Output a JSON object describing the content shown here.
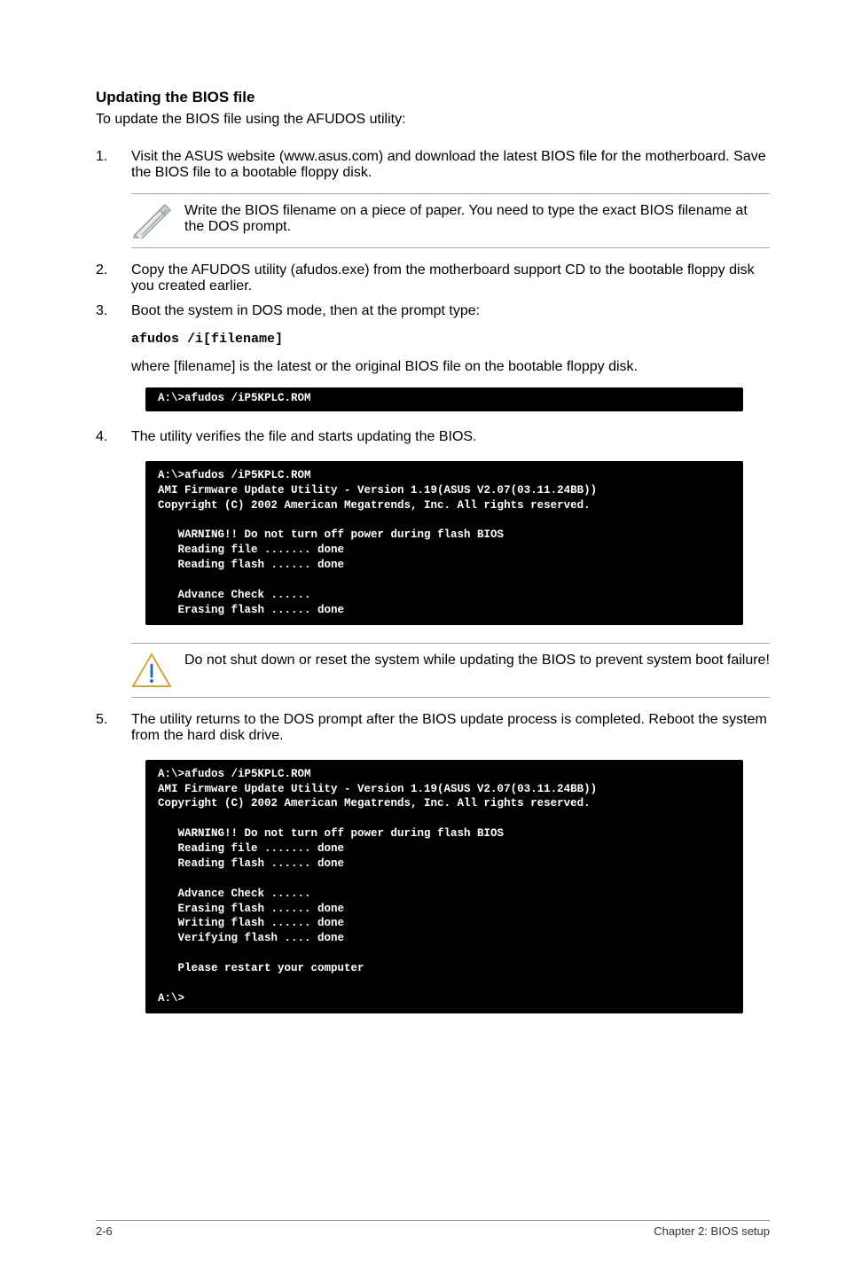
{
  "heading": "Updating the BIOS file",
  "intro": "To update the BIOS file using the AFUDOS utility:",
  "step1_num": "1.",
  "step1_text": "Visit the ASUS website (www.asus.com) and download the latest BIOS file for the motherboard. Save the BIOS file to a bootable floppy disk.",
  "note1": "Write the BIOS filename on a piece of paper. You need to type the exact BIOS filename at the DOS prompt.",
  "step2_num": "2.",
  "step2_text": "Copy the AFUDOS utility (afudos.exe) from the motherboard support CD to the bootable floppy disk you created earlier.",
  "step3_num": "3.",
  "step3_text": "Boot the system in DOS mode, then at the prompt type:",
  "afudos_cmd": "afudos /i[filename]",
  "where_line": "where [filename] is the latest or the original BIOS file on the bootable floppy disk.",
  "dos1": "A:\\>afudos /iP5KPLC.ROM",
  "step4_num": "4.",
  "step4_text": "The utility verifies the file and starts updating the BIOS.",
  "dos2": "A:\\>afudos /iP5KPLC.ROM\nAMI Firmware Update Utility - Version 1.19(ASUS V2.07(03.11.24BB))\nCopyright (C) 2002 American Megatrends, Inc. All rights reserved.\n\n   WARNING!! Do not turn off power during flash BIOS\n   Reading file ....... done\n   Reading flash ...... done\n\n   Advance Check ......\n   Erasing flash ...... done",
  "note2": "Do not shut down or reset the system while updating the BIOS to prevent system boot failure!",
  "step5_num": "5.",
  "step5_text": "The utility returns to the DOS prompt after the BIOS update process is completed. Reboot the system from the hard disk drive.",
  "dos3": "A:\\>afudos /iP5KPLC.ROM\nAMI Firmware Update Utility - Version 1.19(ASUS V2.07(03.11.24BB))\nCopyright (C) 2002 American Megatrends, Inc. All rights reserved.\n\n   WARNING!! Do not turn off power during flash BIOS\n   Reading file ....... done\n   Reading flash ...... done\n\n   Advance Check ......\n   Erasing flash ...... done\n   Writing flash ...... done\n   Verifying flash .... done\n\n   Please restart your computer\n\nA:\\>",
  "footer_left": "2-6",
  "footer_right": "Chapter 2: BIOS setup"
}
